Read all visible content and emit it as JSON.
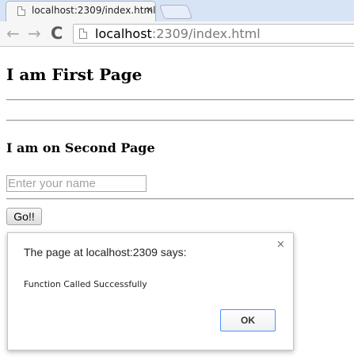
{
  "browser": {
    "tab": {
      "title": "localhost:2309/index.html",
      "close_glyph": "✕",
      "icon": "page-icon"
    },
    "toolbar": {
      "back_glyph": "←",
      "forward_glyph": "→",
      "reload_glyph": "C",
      "url_host": "localhost",
      "url_rest": ":2309/index.html",
      "page_icon": "page-icon"
    }
  },
  "page": {
    "heading_first": "I am First Page",
    "heading_second": "I am on Second Page",
    "name_input": {
      "placeholder": "Enter your name",
      "value": ""
    },
    "go_button_label": "Go!!"
  },
  "dialog": {
    "title": "The page at localhost:2309 says:",
    "close_glyph": "×",
    "message": "Function Called Successfully",
    "ok_label": "OK"
  },
  "colors": {
    "tabstrip_bg": "#d7e4f6",
    "toolbar_bg": "#f6f6f6",
    "dialog_ok_border": "#4d90fe",
    "url_rest_color": "#7a7a7a"
  }
}
